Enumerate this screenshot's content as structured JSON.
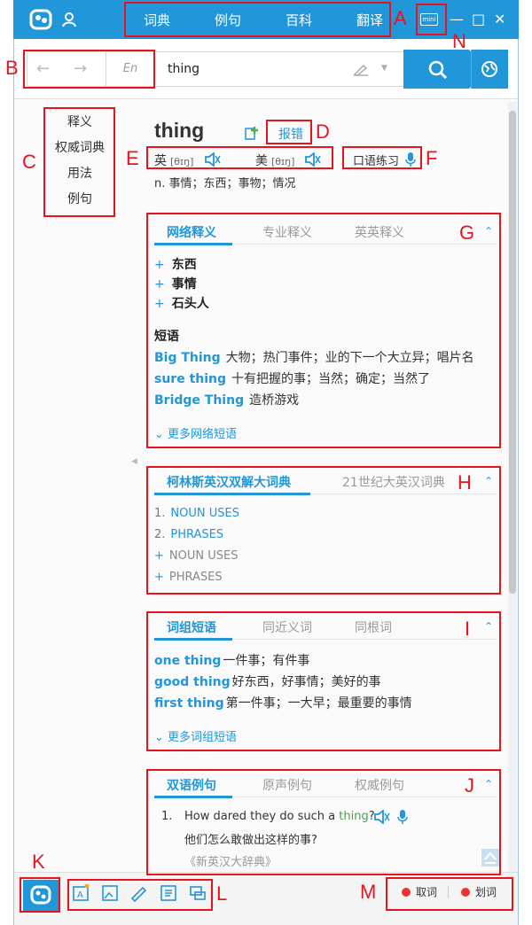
{
  "titlebar": {
    "nav": [
      "词典",
      "例句",
      "百科",
      "翻译"
    ],
    "mini_label": "mini",
    "controls": [
      "—",
      "□",
      "✕"
    ]
  },
  "search": {
    "lang_label": "En",
    "query": "thing"
  },
  "side_nav": [
    "释义",
    "权威词典",
    "用法",
    "例句"
  ],
  "word": {
    "headword": "thing",
    "report_label": "报错",
    "uk_label": "英",
    "uk_ipa": "[θɪŋ]",
    "us_label": "美",
    "us_ipa": "[θɪŋ]",
    "practice_label": "口语练习",
    "basic_def": "n. 事情；东西；事物；情况"
  },
  "web_panel": {
    "tabs": [
      "网络释义",
      "专业释义",
      "英英释义"
    ],
    "senses": [
      "东西",
      "事情",
      "石头人"
    ],
    "phrases_heading": "短语",
    "phrases": [
      {
        "en": "Big Thing",
        "cn": "大物；热门事件；业的下一个大立异；唱片名"
      },
      {
        "en": "sure thing",
        "cn": "十有把握的事；当然；确定；当然了"
      },
      {
        "en": "Bridge Thing",
        "cn": "造桥游戏"
      }
    ],
    "more": "更多网络短语"
  },
  "collins_panel": {
    "tabs": [
      "柯林斯英汉双解大词典",
      "21世纪大英汉词典"
    ],
    "items": [
      {
        "num": "1.",
        "label": "NOUN USES"
      },
      {
        "num": "2.",
        "label": "PHRASES"
      },
      {
        "num": "+",
        "label": "NOUN USES"
      },
      {
        "num": "+",
        "label": "PHRASES"
      }
    ]
  },
  "phrase_panel": {
    "tabs": [
      "词组短语",
      "同近义词",
      "同根词"
    ],
    "rows": [
      {
        "en": "one thing",
        "cn": "一件事；有件事"
      },
      {
        "en": "good thing",
        "cn": "好东西，好事情；美好的事"
      },
      {
        "en": "first thing",
        "cn": "第一件事；一大早；最重要的事情"
      }
    ],
    "more": "更多词组短语"
  },
  "example_panel": {
    "tabs": [
      "双语例句",
      "原声例句",
      "权威例句"
    ],
    "num": "1.",
    "en_before": "How dared they do such a ",
    "en_hl": "thing",
    "en_after": "?",
    "cn": "他们怎么敢做出这样的事?",
    "source": "《新英汉大辞典》"
  },
  "bottom": {
    "pick_word": "取词",
    "select_word": "划词"
  },
  "annotations": [
    "A",
    "B",
    "C",
    "D",
    "E",
    "F",
    "G",
    "H",
    "I",
    "J",
    "K",
    "L",
    "M",
    "N"
  ],
  "colors": {
    "accent": "#2196d8",
    "annotation": "#e8141d",
    "highlight": "#4aa04a"
  }
}
